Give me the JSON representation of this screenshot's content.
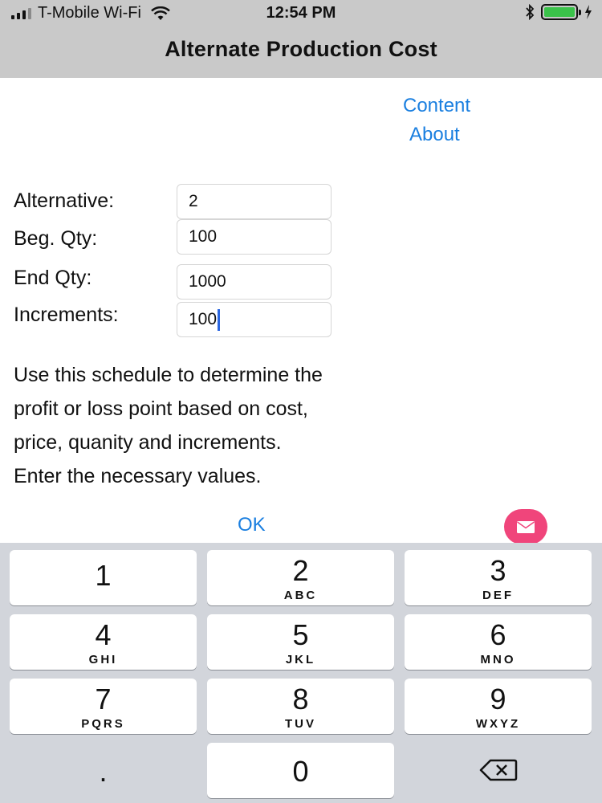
{
  "status": {
    "carrier": "T-Mobile Wi-Fi",
    "time": "12:54 PM"
  },
  "nav": {
    "title": "Alternate Production Cost"
  },
  "links": {
    "content": "Content",
    "about": "About"
  },
  "form": {
    "alternative": {
      "label": "Alternative:",
      "value": "2"
    },
    "beg_qty": {
      "label": "Beg. Qty:",
      "value": "100"
    },
    "end_qty": {
      "label": "End Qty:",
      "value": "1000"
    },
    "increments": {
      "label": "Increments:",
      "value": "100"
    }
  },
  "description": [
    "Use this schedule to determine the",
    "profit or loss point based on cost,",
    "price, quanity and increments.",
    "Enter the necessary values."
  ],
  "ok_label": "OK",
  "keypad": {
    "k1": {
      "num": "1",
      "letters": ""
    },
    "k2": {
      "num": "2",
      "letters": "ABC"
    },
    "k3": {
      "num": "3",
      "letters": "DEF"
    },
    "k4": {
      "num": "4",
      "letters": "GHI"
    },
    "k5": {
      "num": "5",
      "letters": "JKL"
    },
    "k6": {
      "num": "6",
      "letters": "MNO"
    },
    "k7": {
      "num": "7",
      "letters": "PQRS"
    },
    "k8": {
      "num": "8",
      "letters": "TUV"
    },
    "k9": {
      "num": "9",
      "letters": "WXYZ"
    },
    "k0": {
      "num": "0"
    },
    "decimal": "."
  },
  "colors": {
    "link": "#1a7fe0",
    "mail_button": "#f0457b",
    "battery": "#3ac24a",
    "bar": "#c9c9c9",
    "keypad_bg": "#d2d5db"
  },
  "icons": {
    "signal": "signal-icon",
    "wifi": "wifi-icon",
    "bluetooth": "bluetooth-icon",
    "battery": "battery-icon",
    "charging": "charging-icon",
    "mail": "mail-icon",
    "backspace": "backspace-icon"
  }
}
